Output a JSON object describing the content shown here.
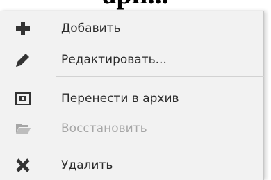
{
  "background": {
    "heading_fragment": "ари..."
  },
  "menu": {
    "items": [
      {
        "label": "Добавить",
        "icon": "plus-icon",
        "disabled": false
      },
      {
        "label": "Редактировать...",
        "icon": "pencil-icon",
        "disabled": false
      },
      {
        "label": "Перенести в архив",
        "icon": "archive-icon",
        "disabled": false
      },
      {
        "label": "Восстановить",
        "icon": "folder-open-icon",
        "disabled": true
      },
      {
        "label": "Удалить",
        "icon": "close-icon",
        "disabled": false
      }
    ]
  },
  "colors": {
    "menu_background": "#f2f2f2",
    "icon_color": "#333333",
    "disabled_color": "#a6a6a6",
    "separator": "#d2d2d2"
  }
}
